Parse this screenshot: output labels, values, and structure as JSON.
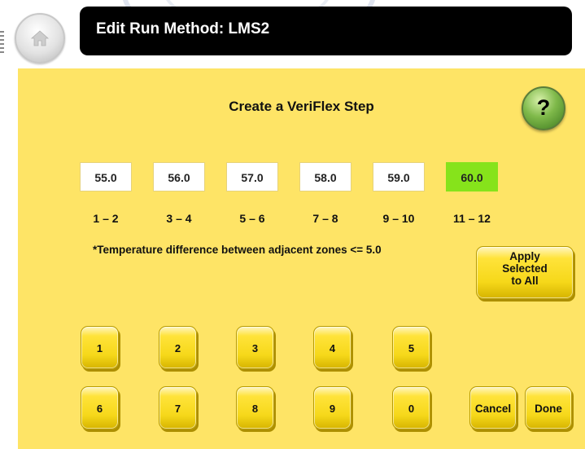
{
  "header": {
    "title": "Edit Run Method: LMS2"
  },
  "icons": {
    "home": "home-icon",
    "help": "help-icon"
  },
  "panel": {
    "title": "Create a VeriFlex Step",
    "help_label": "?",
    "note": "*Temperature difference between adjacent zones <= 5.0",
    "zones": [
      {
        "value": "55.0",
        "label": "1 – 2",
        "selected": false
      },
      {
        "value": "56.0",
        "label": "3 – 4",
        "selected": false
      },
      {
        "value": "57.0",
        "label": "5 – 6",
        "selected": false
      },
      {
        "value": "58.0",
        "label": "7 – 8",
        "selected": false
      },
      {
        "value": "59.0",
        "label": "9 – 10",
        "selected": false
      },
      {
        "value": "60.0",
        "label": "11 – 12",
        "selected": true
      }
    ],
    "apply": {
      "line1": "Apply",
      "line2": "Selected",
      "line3": "to All"
    },
    "keypad": [
      "1",
      "2",
      "3",
      "4",
      "5",
      "6",
      "7",
      "8",
      "9",
      "0"
    ],
    "cancel_label": "Cancel",
    "done_label": "Done"
  },
  "colors": {
    "panel_background": "#fee466",
    "selected_zone": "#86e31b",
    "button_yellow": "#ffe33a",
    "title_bar": "#000000",
    "help_button": "#7fb94a"
  }
}
